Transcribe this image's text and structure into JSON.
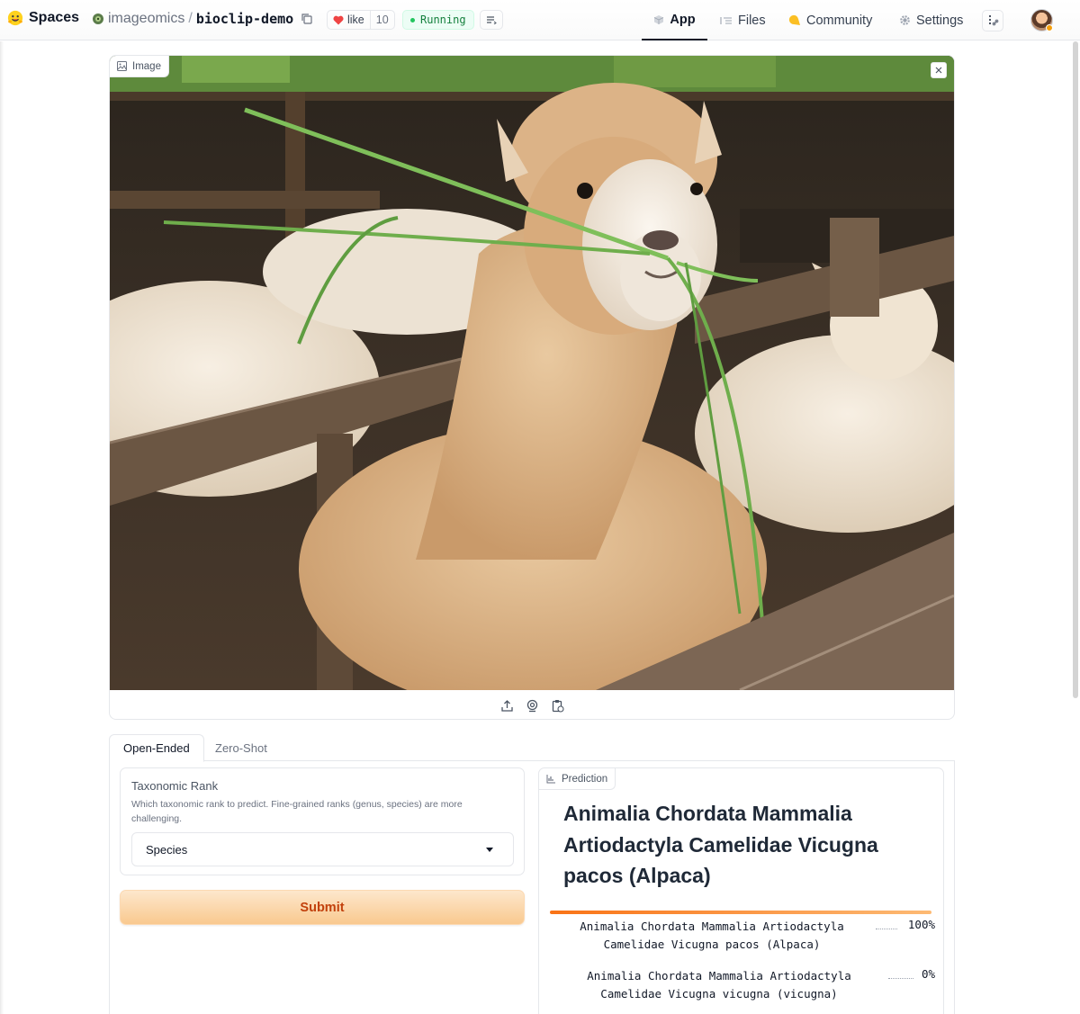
{
  "header": {
    "brand": "Spaces",
    "org": "imageomics",
    "separator": "/",
    "repo": "bioclip-demo",
    "like_label": "like",
    "like_count": "10",
    "status": "Running",
    "nav": [
      {
        "label": "App",
        "icon": "cube-icon",
        "active": true
      },
      {
        "label": "Files",
        "icon": "files-icon",
        "active": false
      },
      {
        "label": "Community",
        "icon": "community-icon",
        "active": false
      },
      {
        "label": "Settings",
        "icon": "gear-icon",
        "active": false
      }
    ]
  },
  "image_panel": {
    "label": "Image",
    "tools": [
      "upload-icon",
      "webcam-icon",
      "clipboard-icon"
    ]
  },
  "tabs": [
    {
      "label": "Open-Ended",
      "active": true
    },
    {
      "label": "Zero-Shot",
      "active": false
    }
  ],
  "taxonomic_rank": {
    "title": "Taxonomic Rank",
    "info": "Which taxonomic rank to predict. Fine-grained ranks (genus, species) are more challenging.",
    "selected": "Species"
  },
  "submit_label": "Submit",
  "prediction": {
    "label": "Prediction",
    "top": "Animalia Chordata Mammalia Artiodactyla Camelidae Vicugna pacos (Alpaca)",
    "confidences": [
      {
        "label": "Animalia Chordata Mammalia Artiodactyla Camelidae Vicugna pacos (Alpaca)",
        "value_text": "100%",
        "fraction": 1.0
      },
      {
        "label": "Animalia Chordata Mammalia Artiodactyla Camelidae Vicugna vicugna (vicugna)",
        "value_text": "0%",
        "fraction": 0.0
      }
    ]
  },
  "colors": {
    "accent": "#f97316",
    "status_green": "#22c55e",
    "heart": "#ef4444"
  }
}
